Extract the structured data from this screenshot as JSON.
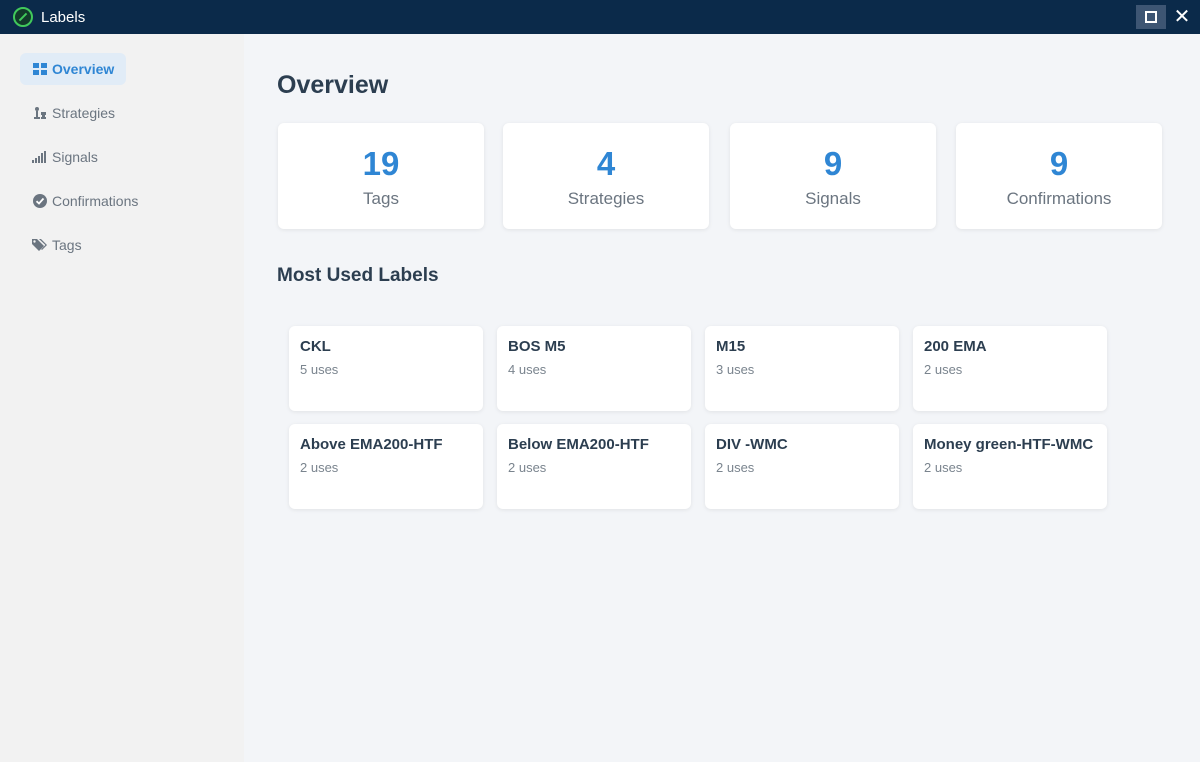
{
  "window": {
    "title": "Labels"
  },
  "sidebar": {
    "items": [
      {
        "label": "Overview",
        "icon": "grid-icon",
        "active": true
      },
      {
        "label": "Strategies",
        "icon": "chess-icon",
        "active": false
      },
      {
        "label": "Signals",
        "icon": "signal-bars-icon",
        "active": false
      },
      {
        "label": "Confirmations",
        "icon": "check-circle-icon",
        "active": false
      },
      {
        "label": "Tags",
        "icon": "tags-icon",
        "active": false
      }
    ]
  },
  "main": {
    "title": "Overview",
    "stats": [
      {
        "value": "19",
        "label": "Tags"
      },
      {
        "value": "4",
        "label": "Strategies"
      },
      {
        "value": "9",
        "label": "Signals"
      },
      {
        "value": "9",
        "label": "Confirmations"
      }
    ],
    "most_used_title": "Most Used Labels",
    "labels": [
      {
        "name": "CKL",
        "uses": "5 uses"
      },
      {
        "name": "BOS M5",
        "uses": "4 uses"
      },
      {
        "name": "M15",
        "uses": "3 uses"
      },
      {
        "name": "200 EMA",
        "uses": "2 uses"
      },
      {
        "name": "Above EMA200-HTF",
        "uses": "2 uses"
      },
      {
        "name": "Below EMA200-HTF",
        "uses": "2 uses"
      },
      {
        "name": "DIV -WMC",
        "uses": "2 uses"
      },
      {
        "name": "Money green-HTF-WMC",
        "uses": "2 uses"
      }
    ]
  },
  "colors": {
    "titlebar": "#0b2a4a",
    "accent": "#2f86d4",
    "active_nav_bg": "#e1ecf7"
  }
}
